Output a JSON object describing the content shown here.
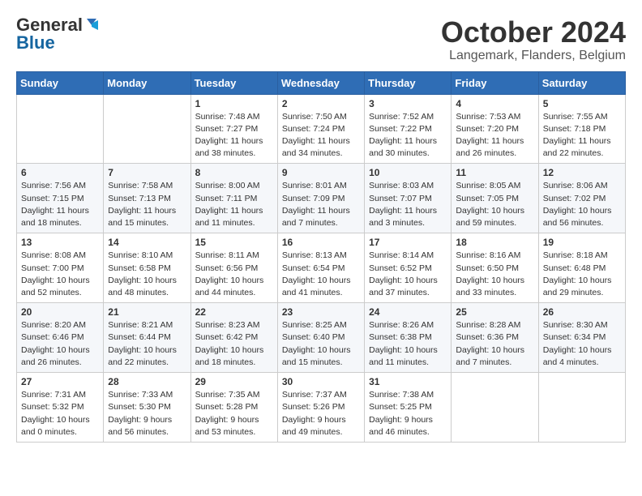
{
  "logo": {
    "general": "General",
    "blue": "Blue"
  },
  "title": {
    "month": "October 2024",
    "location": "Langemark, Flanders, Belgium"
  },
  "headers": [
    "Sunday",
    "Monday",
    "Tuesday",
    "Wednesday",
    "Thursday",
    "Friday",
    "Saturday"
  ],
  "weeks": [
    [
      {
        "day": "",
        "content": ""
      },
      {
        "day": "",
        "content": ""
      },
      {
        "day": "1",
        "content": "Sunrise: 7:48 AM\nSunset: 7:27 PM\nDaylight: 11 hours and 38 minutes."
      },
      {
        "day": "2",
        "content": "Sunrise: 7:50 AM\nSunset: 7:24 PM\nDaylight: 11 hours and 34 minutes."
      },
      {
        "day": "3",
        "content": "Sunrise: 7:52 AM\nSunset: 7:22 PM\nDaylight: 11 hours and 30 minutes."
      },
      {
        "day": "4",
        "content": "Sunrise: 7:53 AM\nSunset: 7:20 PM\nDaylight: 11 hours and 26 minutes."
      },
      {
        "day": "5",
        "content": "Sunrise: 7:55 AM\nSunset: 7:18 PM\nDaylight: 11 hours and 22 minutes."
      }
    ],
    [
      {
        "day": "6",
        "content": "Sunrise: 7:56 AM\nSunset: 7:15 PM\nDaylight: 11 hours and 18 minutes."
      },
      {
        "day": "7",
        "content": "Sunrise: 7:58 AM\nSunset: 7:13 PM\nDaylight: 11 hours and 15 minutes."
      },
      {
        "day": "8",
        "content": "Sunrise: 8:00 AM\nSunset: 7:11 PM\nDaylight: 11 hours and 11 minutes."
      },
      {
        "day": "9",
        "content": "Sunrise: 8:01 AM\nSunset: 7:09 PM\nDaylight: 11 hours and 7 minutes."
      },
      {
        "day": "10",
        "content": "Sunrise: 8:03 AM\nSunset: 7:07 PM\nDaylight: 11 hours and 3 minutes."
      },
      {
        "day": "11",
        "content": "Sunrise: 8:05 AM\nSunset: 7:05 PM\nDaylight: 10 hours and 59 minutes."
      },
      {
        "day": "12",
        "content": "Sunrise: 8:06 AM\nSunset: 7:02 PM\nDaylight: 10 hours and 56 minutes."
      }
    ],
    [
      {
        "day": "13",
        "content": "Sunrise: 8:08 AM\nSunset: 7:00 PM\nDaylight: 10 hours and 52 minutes."
      },
      {
        "day": "14",
        "content": "Sunrise: 8:10 AM\nSunset: 6:58 PM\nDaylight: 10 hours and 48 minutes."
      },
      {
        "day": "15",
        "content": "Sunrise: 8:11 AM\nSunset: 6:56 PM\nDaylight: 10 hours and 44 minutes."
      },
      {
        "day": "16",
        "content": "Sunrise: 8:13 AM\nSunset: 6:54 PM\nDaylight: 10 hours and 41 minutes."
      },
      {
        "day": "17",
        "content": "Sunrise: 8:14 AM\nSunset: 6:52 PM\nDaylight: 10 hours and 37 minutes."
      },
      {
        "day": "18",
        "content": "Sunrise: 8:16 AM\nSunset: 6:50 PM\nDaylight: 10 hours and 33 minutes."
      },
      {
        "day": "19",
        "content": "Sunrise: 8:18 AM\nSunset: 6:48 PM\nDaylight: 10 hours and 29 minutes."
      }
    ],
    [
      {
        "day": "20",
        "content": "Sunrise: 8:20 AM\nSunset: 6:46 PM\nDaylight: 10 hours and 26 minutes."
      },
      {
        "day": "21",
        "content": "Sunrise: 8:21 AM\nSunset: 6:44 PM\nDaylight: 10 hours and 22 minutes."
      },
      {
        "day": "22",
        "content": "Sunrise: 8:23 AM\nSunset: 6:42 PM\nDaylight: 10 hours and 18 minutes."
      },
      {
        "day": "23",
        "content": "Sunrise: 8:25 AM\nSunset: 6:40 PM\nDaylight: 10 hours and 15 minutes."
      },
      {
        "day": "24",
        "content": "Sunrise: 8:26 AM\nSunset: 6:38 PM\nDaylight: 10 hours and 11 minutes."
      },
      {
        "day": "25",
        "content": "Sunrise: 8:28 AM\nSunset: 6:36 PM\nDaylight: 10 hours and 7 minutes."
      },
      {
        "day": "26",
        "content": "Sunrise: 8:30 AM\nSunset: 6:34 PM\nDaylight: 10 hours and 4 minutes."
      }
    ],
    [
      {
        "day": "27",
        "content": "Sunrise: 7:31 AM\nSunset: 5:32 PM\nDaylight: 10 hours and 0 minutes."
      },
      {
        "day": "28",
        "content": "Sunrise: 7:33 AM\nSunset: 5:30 PM\nDaylight: 9 hours and 56 minutes."
      },
      {
        "day": "29",
        "content": "Sunrise: 7:35 AM\nSunset: 5:28 PM\nDaylight: 9 hours and 53 minutes."
      },
      {
        "day": "30",
        "content": "Sunrise: 7:37 AM\nSunset: 5:26 PM\nDaylight: 9 hours and 49 minutes."
      },
      {
        "day": "31",
        "content": "Sunrise: 7:38 AM\nSunset: 5:25 PM\nDaylight: 9 hours and 46 minutes."
      },
      {
        "day": "",
        "content": ""
      },
      {
        "day": "",
        "content": ""
      }
    ]
  ]
}
